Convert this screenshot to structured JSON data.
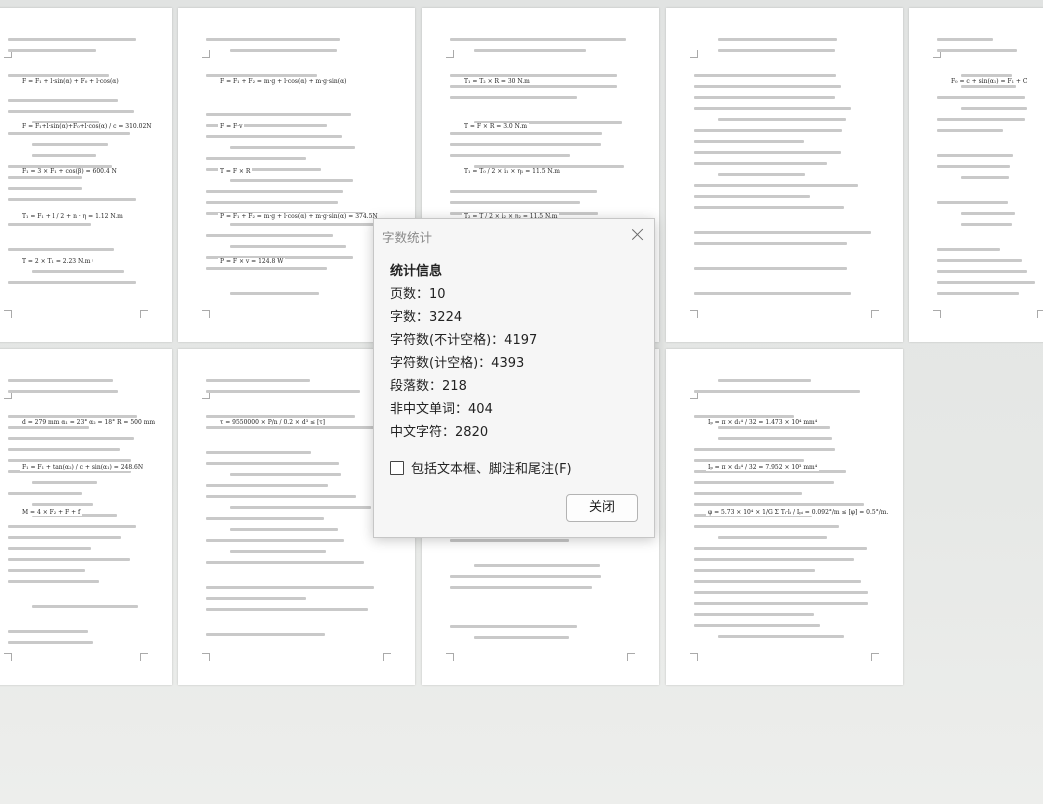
{
  "window": {
    "background": "#e6e8e6"
  },
  "pages": [
    {
      "id": "p1",
      "formulas": [
        "F = F₁ + l·sin(α) + F₀ + l·cos(α)",
        "F = F₁+l·sin(α)+F₀+l·cos(α) / c = 310.02N",
        "F₁ = 3 × F₁ + cos(β) = 600.4 N",
        "T₁ = F₁ + l / 2 + n · η = 1.12 N.m",
        "T = 2 × T₁ = 2.23 N.m"
      ]
    },
    {
      "id": "p2",
      "formulas": [
        "F = F₁ + F₂ = m·g + l·cos(α) + m·g·sin(α)",
        "F = F·v",
        "T = F × R",
        "P = F₁ + F₂ = m·g + l·cos(α) + m·g·sin(α) = 374.5N",
        "P = F × v = 124.8 W"
      ]
    },
    {
      "id": "p3",
      "formulas": [
        "T₁ = T₂ × R = 30 N.m",
        "T = F × R = 3.0 N.m",
        "T₁ = T₀ / 2 × i₁ × η₁ = 11.5 N.m",
        "T₂ = T / 2 × i₂ × η₂ = 11.5 N.m",
        "P₁ = P × C₁ × C₂ / 2 × η₁ × η₂"
      ]
    },
    {
      "id": "p4",
      "formulas": []
    },
    {
      "id": "p5",
      "formulas": [
        "F₀ = c + sin(α₁) = F₁ + C"
      ]
    },
    {
      "id": "p6",
      "formulas": [
        "d = 279 mm   α₁ = 23°   α₂ = 18°   R = 500 mm",
        "F₁ = F₁ + tan(α₂) / c + sin(α₁) = 248.6N",
        "M = 4 × F₂ + F + f"
      ]
    },
    {
      "id": "p7",
      "formulas": [
        "τ = 9550000 × P/n / 0.2 × d³ ≤ [τ]"
      ]
    },
    {
      "id": "p8",
      "formulas": [
        "[φ] — 许用扭转角，数字需用[φ] = 0.5°/m."
      ]
    },
    {
      "id": "p9",
      "formulas": [
        "Iₚ = π × d₁⁴ / 32 = 1.473 × 10⁴ mm⁴",
        "Iₚ = π × d₂⁴ / 32 = 7.952 × 10³ mm⁴",
        "φ = 5.73 × 10⁴ × 1/G Σ Tᵢ·lᵢ / Iₚᵢ = 0.092°/m ≤ [φ] = 0.5°/m."
      ]
    }
  ],
  "dialog": {
    "title": "字数统计",
    "section_title": "统计信息",
    "stats": [
      {
        "label": "页数",
        "value": "10"
      },
      {
        "label": "字数",
        "value": "3224"
      },
      {
        "label": "字符数(不计空格)",
        "value": "4197"
      },
      {
        "label": "字符数(计空格)",
        "value": "4393"
      },
      {
        "label": "段落数",
        "value": "218"
      },
      {
        "label": "非中文单词",
        "value": "404"
      },
      {
        "label": "中文字符",
        "value": "2820"
      }
    ],
    "checkbox_label": "包括文本框、脚注和尾注(F)",
    "checkbox_checked": false,
    "close_button": "关闭"
  }
}
